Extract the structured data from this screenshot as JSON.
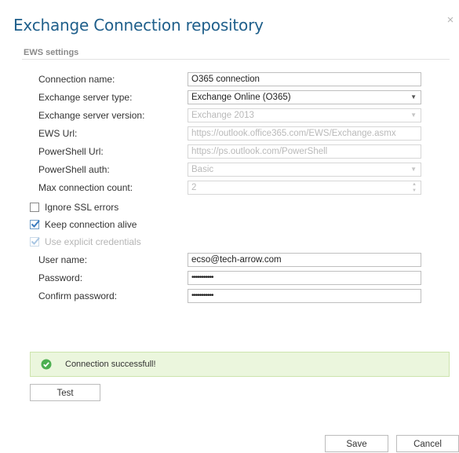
{
  "dialog": {
    "title": "Exchange Connection repository",
    "close_glyph": "×"
  },
  "section": {
    "title": "EWS settings"
  },
  "form": {
    "connection_name": {
      "label": "Connection name:",
      "value": "O365 connection"
    },
    "server_type": {
      "label": "Exchange server type:",
      "value": "Exchange Online (O365)"
    },
    "server_version": {
      "label": "Exchange server version:",
      "value": "Exchange 2013"
    },
    "ews_url": {
      "label": "EWS Url:",
      "value": "https://outlook.office365.com/EWS/Exchange.asmx"
    },
    "powershell_url": {
      "label": "PowerShell Url:",
      "value": "https://ps.outlook.com/PowerShell"
    },
    "powershell_auth": {
      "label": "PowerShell auth:",
      "value": "Basic"
    },
    "max_connections": {
      "label": "Max connection count:",
      "value": "2"
    },
    "user_name": {
      "label": "User name:",
      "value": "ecso@tech-arrow.com"
    },
    "password": {
      "label": "Password:",
      "value": "•••••••••••"
    },
    "confirm_password": {
      "label": "Confirm password:",
      "value": "•••••••••••"
    }
  },
  "checkboxes": {
    "ignore_ssl": {
      "label": "Ignore SSL errors",
      "checked": false
    },
    "keep_alive": {
      "label": "Keep connection alive",
      "checked": true
    },
    "explicit_credentials": {
      "label": "Use explicit credentials",
      "checked": true,
      "disabled": true
    }
  },
  "status": {
    "text": "Connection successfull!",
    "color": "#4caf50"
  },
  "buttons": {
    "test": "Test",
    "save": "Save",
    "cancel": "Cancel"
  },
  "colors": {
    "title": "#1f5f8b",
    "status_bg": "#ebf6dd",
    "check_accent": "#3a7bbf"
  }
}
